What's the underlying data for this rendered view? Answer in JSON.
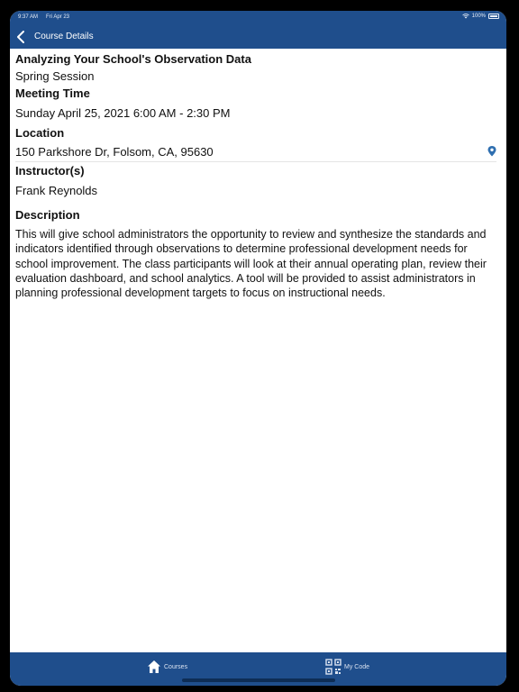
{
  "status_bar": {
    "time": "9:37 AM",
    "date": "Fri Apr 23",
    "battery": "100%"
  },
  "nav": {
    "title": "Course Details",
    "back_icon": "chevron-left-icon"
  },
  "course": {
    "title": "Analyzing Your School's Observation Data",
    "session": "Spring Session",
    "meeting_time_label": "Meeting Time",
    "meeting_time": "Sunday April 25, 2021 6:00 AM - 2:30 PM",
    "location_label": "Location",
    "location": "150 Parkshore Dr, Folsom, CA, 95630",
    "instructors_label": "Instructor(s)",
    "instructor": "Frank Reynolds",
    "description_label": "Description",
    "description": "This will give school administrators the opportunity to review and synthesize the standards and indicators identified through observations to determine professional development needs for school improvement. The class participants will look at their annual operating plan, review their evaluation dashboard, and school analytics. A tool will be provided to assist administrators in planning professional development targets to focus on instructional needs."
  },
  "tabbar": {
    "courses_label": "Courses",
    "mycode_label": "My Code",
    "courses_icon": "home-icon",
    "mycode_icon": "qr-code-icon"
  },
  "colors": {
    "brand": "#1f4e8c",
    "pin": "#2f6fb0"
  }
}
